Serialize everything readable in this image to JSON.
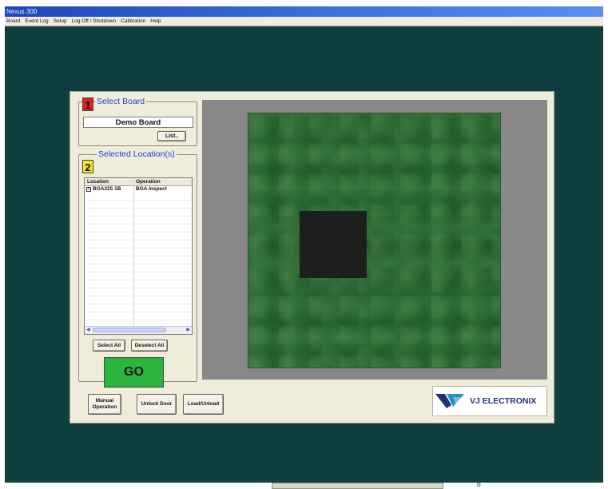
{
  "window": {
    "title": "Nexus 300"
  },
  "menu": [
    "Board",
    "Event Log",
    "Setup",
    "Log Off / Shutdown",
    "Calibration",
    "Help"
  ],
  "select_board": {
    "number": "1",
    "title": "Select Board",
    "value": "Demo Board",
    "list_button": "List.."
  },
  "selected_locations": {
    "number": "2",
    "title": "Selected Location(s)",
    "columns": [
      "Location",
      "Operation"
    ],
    "rows": [
      {
        "checked": true,
        "location": "BGA225 1B",
        "operation": "BGA Inspect"
      }
    ],
    "select_all": "Select All",
    "deselect_all": "Deselect All",
    "go": "GO"
  },
  "bottom_buttons": {
    "manual_line1": "Manual",
    "manual_line2": "Operation",
    "unlock": "Unlock Door",
    "load_unload": "Load/Unload"
  },
  "logo": {
    "text": "VJ ELECTRONIX",
    "color": "#24317a",
    "accent": "#2a8fc0"
  },
  "colors": {
    "background": "#0f3f3f",
    "panel": "#efecd9",
    "go": "#2cb53c",
    "title_blue": "#1f3fd0"
  }
}
